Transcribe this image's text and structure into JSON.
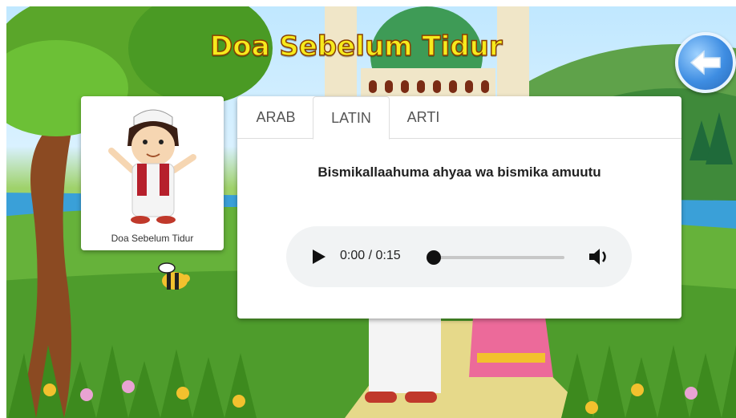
{
  "header": {
    "title": "Doa Sebelum Tidur"
  },
  "icons": {
    "back": "arrow-left-icon",
    "play": "play-icon",
    "volume": "volume-icon"
  },
  "card": {
    "caption": "Doa Sebelum Tidur"
  },
  "tabs": [
    {
      "label": "ARAB"
    },
    {
      "label": "LATIN"
    },
    {
      "label": "ARTI"
    }
  ],
  "active_tab": "LATIN",
  "content": {
    "latin": "Bismikallaahuma ahyaa wa bismika amuutu"
  },
  "player": {
    "time": "0:00 / 0:15",
    "progress": 0
  },
  "colors": {
    "title_fill": "#f6ea1d",
    "title_outline": "#8a3f00",
    "back_button": "#3e8de2",
    "player_bg": "#f1f3f4"
  }
}
